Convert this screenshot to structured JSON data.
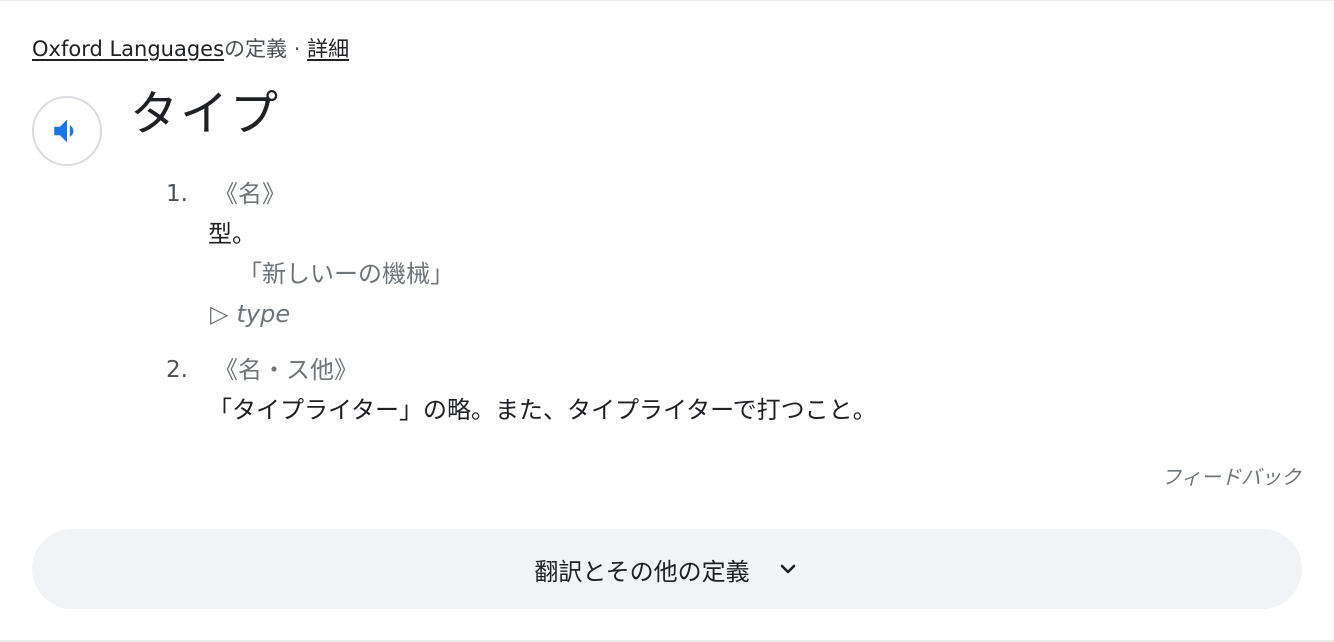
{
  "source": {
    "provider_link": "Oxford Languages",
    "suffix": "の定義",
    "separator": " · ",
    "details_link": "詳細"
  },
  "audio_button": {
    "icon": "speaker-icon"
  },
  "headword": "タイプ",
  "senses": [
    {
      "number": "1.",
      "pos": "《名》",
      "definition": "型。",
      "example": "「新しいーの機械」",
      "translation_marker": "▷",
      "translation": "type"
    },
    {
      "number": "2.",
      "pos": "《名・ス他》",
      "definition": "「タイプライター」の略。また、タイプライターで打つこと。"
    }
  ],
  "feedback": "フィードバック",
  "more_button": {
    "label": "翻訳とその他の定義",
    "icon": "chevron-down-icon"
  },
  "colors": {
    "accent_blue": "#1a73e8",
    "muted_text": "#70757a",
    "button_bg": "#f1f3f4"
  }
}
